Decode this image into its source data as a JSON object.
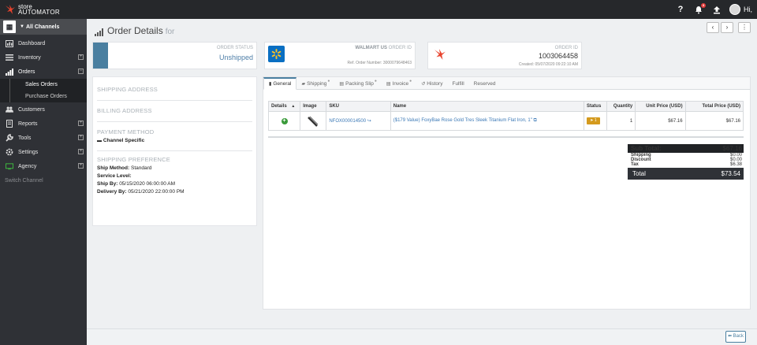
{
  "brand": {
    "line1": "store",
    "line2": "AUTOMATOR"
  },
  "topbar": {
    "help_icon": "question-icon",
    "notifications_count": "3",
    "greeting": "Hi,"
  },
  "sidebar": {
    "channels_label": "All Channels",
    "items": [
      {
        "label": "Dashboard",
        "icon": "dashboard-icon",
        "expandable": false
      },
      {
        "label": "Inventory",
        "icon": "list-icon",
        "expandable": true
      },
      {
        "label": "Orders",
        "icon": "bar-chart-icon",
        "expandable": true,
        "active": true
      },
      {
        "label": "Customers",
        "icon": "users-icon",
        "expandable": false
      },
      {
        "label": "Reports",
        "icon": "report-icon",
        "expandable": true
      },
      {
        "label": "Tools",
        "icon": "wrench-icon",
        "expandable": true
      },
      {
        "label": "Settings",
        "icon": "gear-icon",
        "expandable": true
      },
      {
        "label": "Agency",
        "icon": "monitor-icon",
        "expandable": true
      }
    ],
    "orders_sub": [
      "Sales Orders",
      "Purchase Orders"
    ],
    "switch_channel": "Switch Channel"
  },
  "page": {
    "title": "Order Details",
    "title_suffix": "for"
  },
  "status_card": {
    "label": "ORDER STATUS",
    "value": "Unshipped"
  },
  "channel_card": {
    "label_bold": "WALMART US",
    "label_rest": "ORDER ID",
    "ref_label": "Ref. Order Number:",
    "ref_value": "3000079648463"
  },
  "order_card": {
    "label": "ORDER ID",
    "value": "1003064458",
    "created_label": "Created:",
    "created_value": "05/07/2020 09:22:10 AM"
  },
  "left_panel": {
    "shipping_address": "SHIPPING ADDRESS",
    "billing_address": "BILLING ADDRESS",
    "payment_method": "PAYMENT METHOD",
    "payment_value": "Channel Specific",
    "shipping_preference": "SHIPPING PREFERENCE",
    "ship_method_label": "Ship Method:",
    "ship_method_value": "Standard",
    "service_level_label": "Service Level:",
    "ship_by_label": "Ship By:",
    "ship_by_value": "05/15/2020 06:00:00 AM",
    "delivery_by_label": "Delivery By:",
    "delivery_by_value": "05/21/2020 22:00:00 PM"
  },
  "tabs": [
    "General",
    "Shipping",
    "Packing Slip",
    "Invoice",
    "History",
    "Fulfill",
    "Reserved"
  ],
  "table": {
    "headers": [
      "Details",
      "Image",
      "SKU",
      "Name",
      "Status",
      "Quantity",
      "Unit Price (USD)",
      "Total Price (USD)"
    ],
    "rows": [
      {
        "sku": "NFOX000014500",
        "name": "($179 Value) FoxyBae Rose Gold Tres Sleek Titanium Flat Iron, 1\"",
        "status_text": "1",
        "quantity": "1",
        "unit_price": "$67.16",
        "total_price": "$67.16"
      }
    ]
  },
  "totals": {
    "sub_total_label": "Sub Total:",
    "sub_total": "$67.16",
    "shipping_label": "Shipping",
    "shipping": "$0.00",
    "discount_label": "Discount",
    "discount": "$0.00",
    "tax_label": "Tax",
    "tax": "$6.38",
    "total_label": "Total",
    "total": "$73.54"
  },
  "footer": {
    "back_label": "Back"
  },
  "colors": {
    "accent": "#4a7fa0",
    "topbar": "#26282b",
    "sidebar": "#2f3136",
    "link": "#3c79b6",
    "status_tag": "#d49a1d"
  }
}
